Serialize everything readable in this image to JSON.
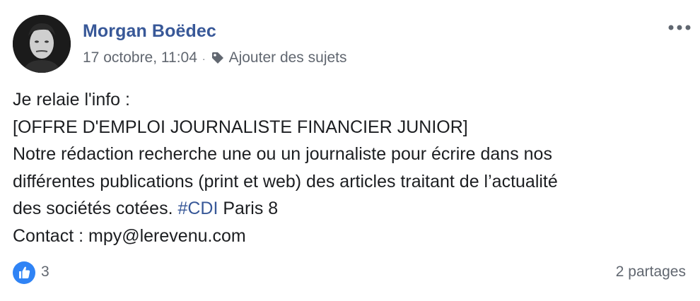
{
  "post": {
    "author": "Morgan Boëdec",
    "timestamp": "17 octobre, 11:04",
    "separator": "·",
    "topics_label": "Ajouter des sujets",
    "content": {
      "line1": "Je relaie l'info :",
      "line2": "[OFFRE D'EMPLOI JOURNALISTE FINANCIER JUNIOR]",
      "line3": "Notre rédaction recherche une ou un journaliste pour écrire dans nos",
      "line4": "différentes publications (print et web) des articles traitant de l’actualité",
      "line5_before": "des sociétés cotées. ",
      "hashtag": "#CDI",
      "line5_after": " Paris 8",
      "line6": "Contact : mpy@lerevenu.com"
    },
    "reactions": {
      "like_count": "3",
      "shares": "2 partages"
    },
    "icons": {
      "more": "more-options-icon",
      "tag": "tag-icon",
      "like": "like-thumb-icon"
    },
    "colors": {
      "link": "#385898",
      "meta": "#616770",
      "text": "#1c1e21",
      "like_blue": "#2f83f5"
    }
  }
}
